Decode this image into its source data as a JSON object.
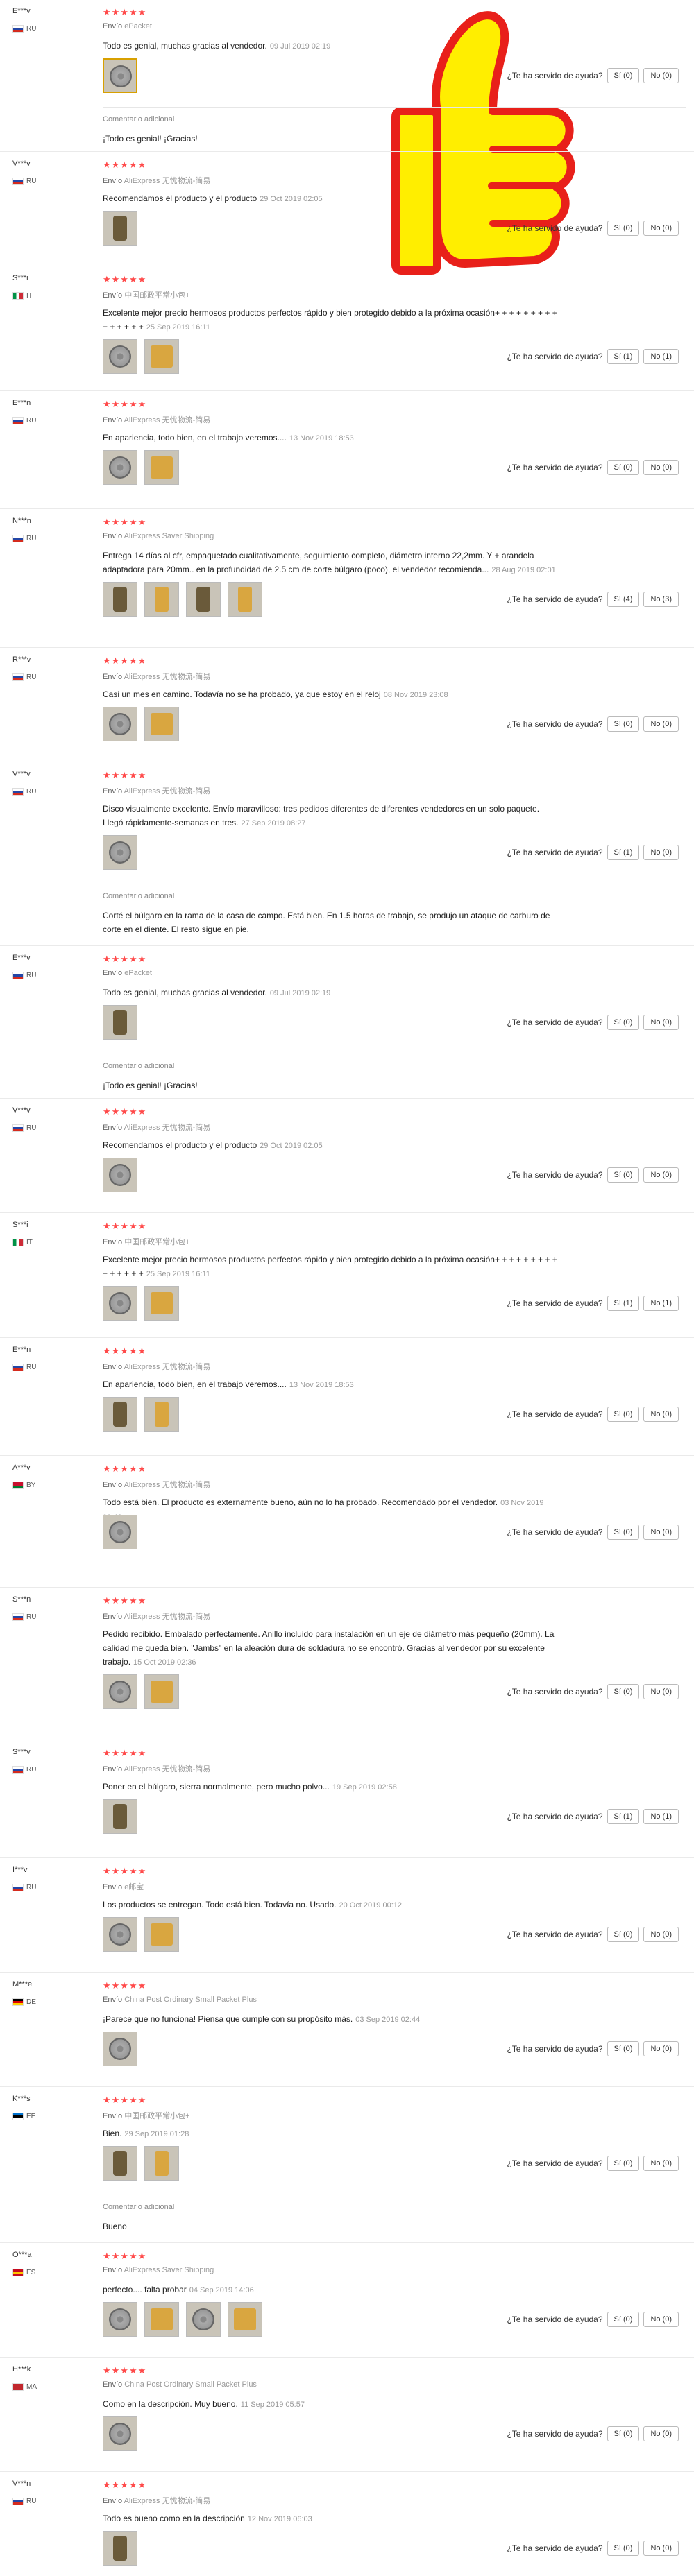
{
  "helpful_q": "¿Te ha servido de ayuda?",
  "ship_label": "Envío",
  "additional_label": "Comentario adicional",
  "reviews": [
    {
      "user": "E***v",
      "country": "RU",
      "method": "ePacket",
      "text": "Todo es genial, muchas gracias al vendedor.",
      "date": "09 Jul 2019 02:19",
      "yes": "Sí (0)",
      "no": "No (0)",
      "add": "¡Todo es genial! ¡Gracias!"
    },
    {
      "user": "V***v",
      "country": "RU",
      "method": "AliExpress 无忧物流-简易",
      "text": "Recomendamos el producto y el producto",
      "date": "29 Oct 2019 02:05",
      "yes": "Sí (0)",
      "no": "No (0)"
    },
    {
      "user": "S***i",
      "country": "IT",
      "method": "中国邮政平常小包+",
      "text": "Excelente mejor precio hermosos productos perfectos rápido y bien protegido debido a la próxima ocasión+ + + + + + + + + + + + + + +",
      "date": "25 Sep 2019 16:11",
      "yes": "Sí (1)",
      "no": "No (1)"
    },
    {
      "user": "E***n",
      "country": "RU",
      "method": "AliExpress 无忧物流-简易",
      "text": "En apariencia, todo bien, en el trabajo veremos....",
      "date": "13 Nov 2019 18:53",
      "yes": "Sí (0)",
      "no": "No (0)"
    },
    {
      "user": "N***n",
      "country": "RU",
      "method": "AliExpress Saver Shipping",
      "text": "Entrega 14 días al cfr, empaquetado cualitativamente, seguimiento completo, diámetro interno 22,2mm. Y + arandela adaptadora para 20mm.. en la profundidad de 2.5 cm de corte búlgaro (poco), el vendedor recomienda...",
      "date": "28 Aug 2019 02:01",
      "yes": "Sí (4)",
      "no": "No (3)"
    },
    {
      "user": "R***v",
      "country": "RU",
      "method": "AliExpress 无忧物流-简易",
      "text": "Casi un mes en camino. Todavía no se ha probado, ya que estoy en el reloj",
      "date": "08 Nov 2019 23:08",
      "yes": "Sí (0)",
      "no": "No (0)"
    },
    {
      "user": "V***v",
      "country": "RU",
      "method": "AliExpress 无忧物流-简易",
      "text": "Disco visualmente excelente. Envío maravilloso: tres pedidos diferentes de diferentes vendedores en un solo paquete. Llegó rápidamente-semanas en tres.",
      "date": "27 Sep 2019 08:27",
      "yes": "Sí (1)",
      "no": "No (0)",
      "add": "Corté el búlgaro en la rama de la casa de campo. Está bien. En 1.5 horas de trabajo, se produjo un ataque de carburo de corte en el diente. El resto sigue en pie."
    },
    {
      "user": "E***v",
      "country": "RU",
      "method": "ePacket",
      "text": "Todo es genial, muchas gracias al vendedor.",
      "date": "09 Jul 2019 02:19",
      "yes": "Sí (0)",
      "no": "No (0)",
      "add": "¡Todo es genial! ¡Gracias!"
    },
    {
      "user": "V***v",
      "country": "RU",
      "method": "AliExpress 无忧物流-简易",
      "text": "Recomendamos el producto y el producto",
      "date": "29 Oct 2019 02:05",
      "yes": "Sí (0)",
      "no": "No (0)"
    },
    {
      "user": "S***i",
      "country": "IT",
      "method": "中国邮政平常小包+",
      "text": "Excelente mejor precio hermosos productos perfectos rápido y bien protegido debido a la próxima ocasión+ + + + + + + + + + + + + + +",
      "date": "25 Sep 2019 16:11",
      "yes": "Sí (1)",
      "no": "No (1)"
    },
    {
      "user": "E***n",
      "country": "RU",
      "method": "AliExpress 无忧物流-简易",
      "text": "En apariencia, todo bien, en el trabajo veremos....",
      "date": "13 Nov 2019 18:53",
      "yes": "Sí (0)",
      "no": "No (0)"
    },
    {
      "user": "A***v",
      "country": "BY",
      "method": "AliExpress 无忧物流-简易",
      "text": "Todo está bien. El producto es externamente bueno, aún no lo ha probado. Recomendado por el vendedor.",
      "date": "03 Nov 2019 00:43",
      "yes": "Sí (0)",
      "no": "No (0)"
    },
    {
      "user": "S***n",
      "country": "RU",
      "method": "AliExpress 无忧物流-简易",
      "text": "Pedido recibido. Embalado perfectamente. Anillo incluido para instalación en un eje de diámetro más pequeño (20mm). La calidad me queda bien. \"Jambs\" en la aleación dura de soldadura no se encontró. Gracias al vendedor por su excelente trabajo.",
      "date": "15 Oct 2019 02:36",
      "yes": "Sí (0)",
      "no": "No (0)"
    },
    {
      "user": "S***v",
      "country": "RU",
      "method": "AliExpress 无忧物流-简易",
      "text": "Poner en el búlgaro, sierra normalmente, pero mucho polvo...",
      "date": "19 Sep 2019 02:58",
      "yes": "Sí (1)",
      "no": "No (1)"
    },
    {
      "user": "I***v",
      "country": "RU",
      "method": "e邮宝",
      "text": "Los productos se entregan. Todo está bien. Todavía no. Usado.",
      "date": "20 Oct 2019 00:12",
      "yes": "Sí (0)",
      "no": "No (0)"
    },
    {
      "user": "M***e",
      "country": "DE",
      "method": "China Post Ordinary Small Packet Plus",
      "text": "¡Parece que no funciona! Piensa que cumple con su propósito más.",
      "date": "03 Sep 2019 02:44",
      "yes": "Sí (0)",
      "no": "No (0)"
    },
    {
      "user": "K***s",
      "country": "EE",
      "method": "中国邮政平常小包+",
      "text": "Bien.",
      "date": "29 Sep 2019 01:28",
      "yes": "Sí (0)",
      "no": "No (0)",
      "add": "Bueno"
    },
    {
      "user": "O***a",
      "country": "ES",
      "method": "AliExpress Saver Shipping",
      "text": "perfecto.... falta probar",
      "date": "04 Sep 2019 14:06",
      "yes": "Sí (0)",
      "no": "No (0)"
    },
    {
      "user": "H***k",
      "country": "MA",
      "method": "China Post Ordinary Small Packet Plus",
      "text": "Como en la descripción. Muy bueno.",
      "date": "11 Sep 2019 05:57",
      "yes": "Sí (0)",
      "no": "No (0)"
    },
    {
      "user": "V***n",
      "country": "RU",
      "method": "AliExpress 无忧物流-简易",
      "text": "Todo es bueno como en la descripción",
      "date": "12 Nov 2019 06:03",
      "yes": "Sí (0)",
      "no": "No (0)"
    }
  ],
  "colors": {
    "star": "#ff4a4a",
    "thumb_yellow": "#ffee00",
    "thumb_red": "#e8201a"
  }
}
